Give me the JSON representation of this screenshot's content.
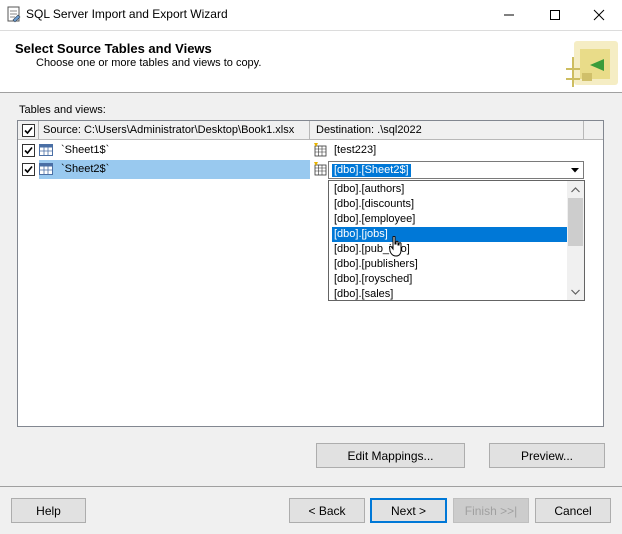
{
  "window": {
    "title": "SQL Server Import and Export Wizard",
    "icon": "wizard-app-icon"
  },
  "header": {
    "title": "Select Source Tables and Views",
    "subtitle": "Choose one or more tables and views to copy."
  },
  "tables": {
    "label": "Tables and views:",
    "columns": {
      "source": "Source: C:\\Users\\Administrator\\Desktop\\Book1.xlsx",
      "destination": "Destination: .\\sql2022"
    },
    "rows": [
      {
        "checked": true,
        "source": "`Sheet1$`",
        "destination": "[test223]",
        "selected": false
      },
      {
        "checked": true,
        "source": "`Sheet2$`",
        "destination": "[dbo].[Sheet2$]",
        "selected": true
      }
    ]
  },
  "dropdown": {
    "options": [
      "[dbo].[authors]",
      "[dbo].[discounts]",
      "[dbo].[employee]",
      "[dbo].[jobs]",
      "[dbo].[pub_info]",
      "[dbo].[publishers]",
      "[dbo].[roysched]",
      "[dbo].[sales]"
    ],
    "highlighted": "[dbo].[jobs]"
  },
  "buttons": {
    "edit_mappings": "Edit Mappings...",
    "preview": "Preview...",
    "help": "Help",
    "back": "< Back",
    "next": "Next >",
    "finish": "Finish >>|",
    "cancel": "Cancel"
  },
  "colors": {
    "selection_blue": "#0078d7",
    "row_highlight": "#99c9ef",
    "dialog_bg": "#f0f0f0"
  }
}
